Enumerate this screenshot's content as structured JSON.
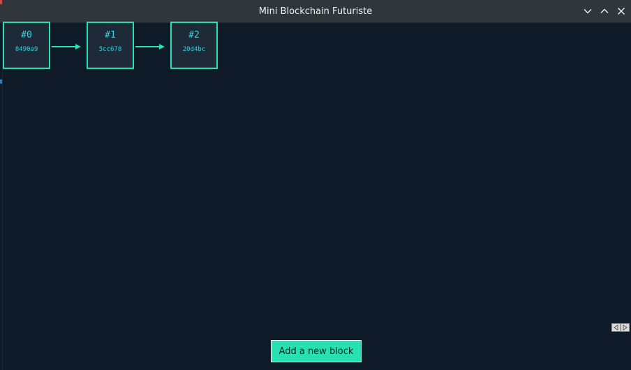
{
  "window": {
    "title": "Mini Blockchain Futuriste",
    "buttons": [
      "minimize",
      "maximize",
      "close"
    ]
  },
  "blocks": [
    {
      "index_label": "#0",
      "hash": "8490a9"
    },
    {
      "index_label": "#1",
      "hash": "5cc678"
    },
    {
      "index_label": "#2",
      "hash": "20d4bc"
    }
  ],
  "actions": {
    "add_block_label": "Add a new block"
  },
  "colors": {
    "background": "#0e1a28",
    "block_fill": "#1e2a38",
    "accent": "#27e1b0",
    "text_cyan": "#2ad8e6",
    "titlebar": "#31363b"
  },
  "icons": {
    "minimize": "chevron-down-icon",
    "maximize": "chevron-up-icon",
    "close": "close-icon",
    "scroll_left": "triangle-left-icon",
    "scroll_right": "triangle-right-icon"
  }
}
